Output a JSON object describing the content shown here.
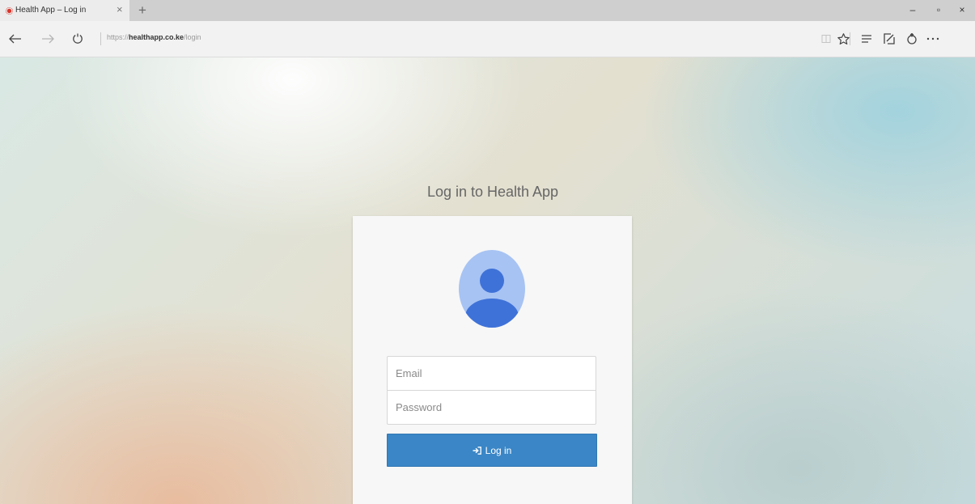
{
  "browser": {
    "tab": {
      "title": "Health App – Log in",
      "close": "×"
    },
    "new_tab": "+",
    "window": {
      "minimize": "–",
      "restore": "▫",
      "close": "×"
    },
    "url": {
      "scheme": "https://",
      "host": "healthapp.co.ke",
      "path": "/login"
    }
  },
  "page": {
    "heading": "Log in to Health App",
    "email": {
      "placeholder": "Email"
    },
    "password": {
      "placeholder": "Password"
    },
    "login_button": "Log in",
    "accent_color": "#3a86c6"
  }
}
